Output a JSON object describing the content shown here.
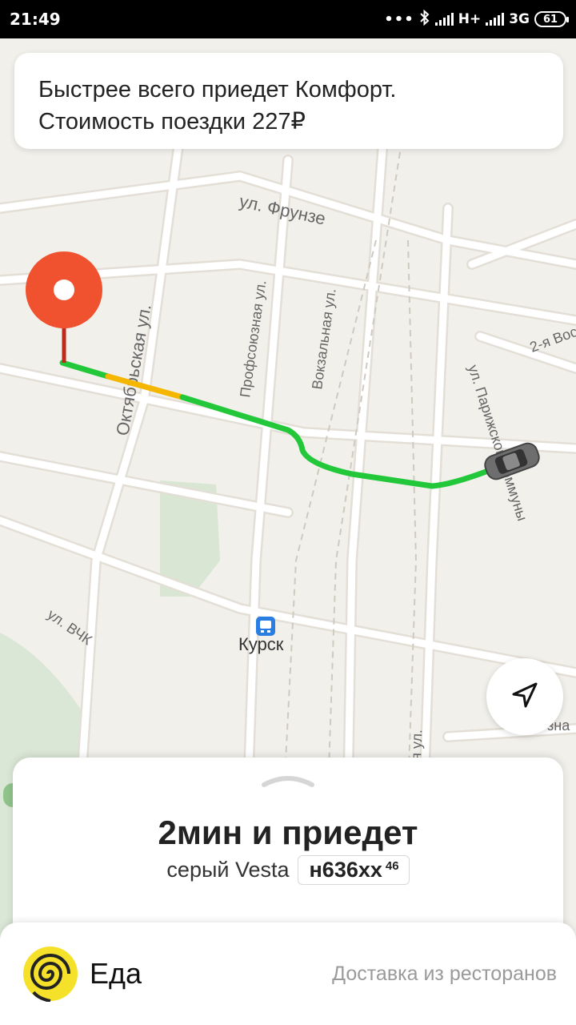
{
  "status_bar": {
    "time": "21:49",
    "network": "H+",
    "network2": "3G",
    "battery": "61"
  },
  "info_card": {
    "line1": "Быстрее всего приедет Комфорт.",
    "line2": "Стоимость поездки 227₽"
  },
  "map": {
    "streets": {
      "frunze": "ул. Фрунзе",
      "oktyabrskaya": "Октябрьская ул.",
      "profsoyuznaya": "Профсоюзная ул.",
      "vokzalnaya": "Вокзальная ул.",
      "parizhskoy": "ул. Парижской Коммуны",
      "vchk": "ул. ВЧК",
      "vos": "2-я Вос",
      "right_edge": "зна",
      "bottom_ul": "я ул."
    },
    "city": "Курск",
    "colors": {
      "route_green": "#22c83a",
      "route_yellow": "#f5b600",
      "pin": "#f0522f",
      "station_icon": "#2a7de1"
    }
  },
  "sheet": {
    "eta": "2мин и приедет",
    "car": "серый Vesta",
    "plate": "н636хх",
    "region": "46"
  },
  "eda": {
    "title": "Еда",
    "subtitle": "Доставка из ресторанов",
    "logo_color": "#f5e12a"
  },
  "icons": {
    "locate": "navigation-arrow-icon",
    "pin": "map-pin-icon",
    "car": "car-icon",
    "station": "train-station-icon"
  }
}
